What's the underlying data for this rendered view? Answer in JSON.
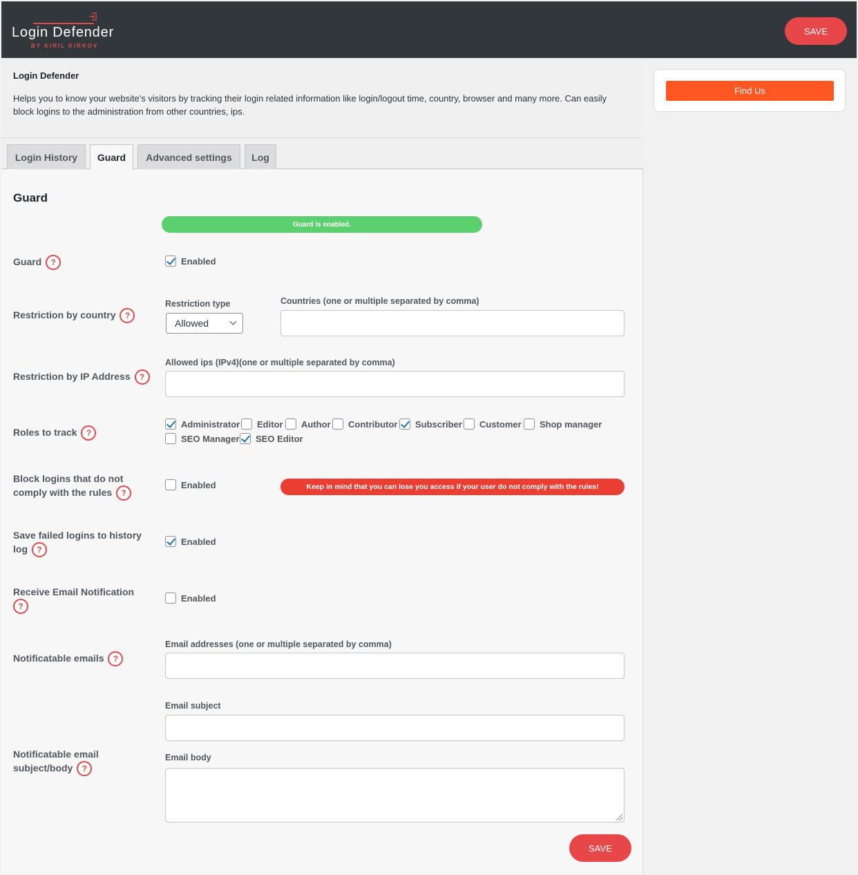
{
  "header": {
    "logo_title": "Login Defender",
    "logo_byline": "BY KIRIL KIRKOV",
    "save_label": "SAVE"
  },
  "intro": {
    "title": "Login Defender",
    "description": "Helps you to know your website's visitors by tracking their login related information like login/logout time, country, browser and many more. Can easily block logins to the administration from other countries, ips."
  },
  "tabs": [
    {
      "label": "Login History",
      "active": false
    },
    {
      "label": "Guard",
      "active": true
    },
    {
      "label": "Advanced settings",
      "active": false
    },
    {
      "label": "Log",
      "active": false
    }
  ],
  "guard": {
    "section_title": "Guard",
    "status_text": "Guard is enabled.",
    "help_glyph": "?",
    "guard_row": {
      "label": "Guard",
      "checkbox_label": "Enabled",
      "checked": true
    },
    "country_row": {
      "label": "Restriction by country",
      "restriction_type_label": "Restriction type",
      "restriction_type_value": "Allowed",
      "countries_label": "Countries (one or multiple separated by comma)",
      "countries_value": ""
    },
    "ip_row": {
      "label": "Restriction by IP Address",
      "ips_label": "Allowed ips (IPv4)(one or multiple separated by comma)",
      "ips_value": ""
    },
    "roles_row": {
      "label": "Roles to track",
      "roles": [
        {
          "label": "Administrator",
          "checked": true
        },
        {
          "label": "Editor",
          "checked": false
        },
        {
          "label": "Author",
          "checked": false
        },
        {
          "label": "Contributor",
          "checked": false
        },
        {
          "label": "Subscriber",
          "checked": true
        },
        {
          "label": "Customer",
          "checked": false
        },
        {
          "label": "Shop manager",
          "checked": false
        },
        {
          "label": "SEO Manager",
          "checked": false
        },
        {
          "label": "SEO Editor",
          "checked": true
        }
      ]
    },
    "block_row": {
      "label_line1": "Block logins that do not",
      "label_line2": "comply with the rules",
      "checkbox_label": "Enabled",
      "checked": false,
      "warning": "Keep in mind that you can lose you access if your user do not comply with the rules!"
    },
    "failed_row": {
      "label_line1": "Save failed logins to history",
      "label_line2": "log",
      "checkbox_label": "Enabled",
      "checked": true
    },
    "email_notif_row": {
      "label": "Receive Email Notification",
      "checkbox_label": "Enabled",
      "checked": false
    },
    "emails_row": {
      "label": "Notificatable emails",
      "emails_label": "Email addresses (one or multiple separated by comma)",
      "emails_value": ""
    },
    "subject_body_row": {
      "label_line1": "Notificatable email",
      "label_line2": "subject/body",
      "subject_label": "Email subject",
      "subject_value": "",
      "body_label": "Email body",
      "body_value": ""
    },
    "save_label": "SAVE"
  },
  "sidebar": {
    "find_us_label": "Find Us"
  },
  "colors": {
    "header_bg": "#32373c",
    "accent_red": "#e8474a",
    "status_green": "#5ccf6e",
    "warning_red": "#eb3e33",
    "find_us_orange": "#ff5722",
    "checkbox_blue": "#2271b1"
  }
}
